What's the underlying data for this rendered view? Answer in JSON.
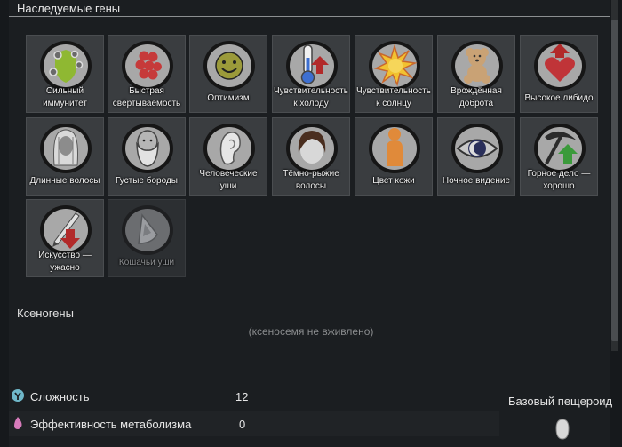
{
  "header": {
    "title": "Наследуемые гены"
  },
  "genes": [
    {
      "label": "Сильный иммунитет",
      "icon": "strong-immunity-icon",
      "disabled": false
    },
    {
      "label": "Быстрая свёртываемость",
      "icon": "fast-clotting-icon",
      "disabled": false
    },
    {
      "label": "Оптимизм",
      "icon": "optimism-icon",
      "disabled": false
    },
    {
      "label": "Чувствительность к холоду",
      "icon": "cold-sensitivity-icon",
      "disabled": false
    },
    {
      "label": "Чувствительность к солнцу",
      "icon": "sun-sensitivity-icon",
      "disabled": false
    },
    {
      "label": "Врождённая доброта",
      "icon": "kindness-icon",
      "disabled": false
    },
    {
      "label": "Высокое либидо",
      "icon": "high-libido-icon",
      "disabled": false
    },
    {
      "label": "Длинные волосы",
      "icon": "long-hair-icon",
      "disabled": false
    },
    {
      "label": "Густые бороды",
      "icon": "thick-beard-icon",
      "disabled": false
    },
    {
      "label": "Человеческие уши",
      "icon": "human-ears-icon",
      "disabled": false
    },
    {
      "label": "Тёмно-рыжие волосы",
      "icon": "dark-red-hair-icon",
      "disabled": false
    },
    {
      "label": "Цвет кожи",
      "icon": "skin-color-icon",
      "disabled": false
    },
    {
      "label": "Ночное видение",
      "icon": "night-vision-icon",
      "disabled": false
    },
    {
      "label": "Горное дело — хорошо",
      "icon": "mining-good-icon",
      "disabled": false
    },
    {
      "label": "Искусство — ужасно",
      "icon": "art-awful-icon",
      "disabled": false
    },
    {
      "label": "Кошачьи уши",
      "icon": "cat-ears-icon",
      "disabled": true
    }
  ],
  "xenogenes": {
    "title": "Ксеногены",
    "empty_text": "(ксеносемя не вживлено)"
  },
  "stats": [
    {
      "label": "Сложность",
      "value": "12",
      "icon": "complexity-icon",
      "color": "#6fb7c9"
    },
    {
      "label": "Эффективность метаболизма",
      "value": "0",
      "icon": "metabolism-icon",
      "color": "#d77bbb"
    }
  ],
  "base": {
    "title": "Базовый пещероид",
    "icon": "xenotype-icon"
  },
  "colors": {
    "accent_red": "#b22a2a",
    "accent_green": "#3b9a3b",
    "tile": "#3a3d40"
  }
}
